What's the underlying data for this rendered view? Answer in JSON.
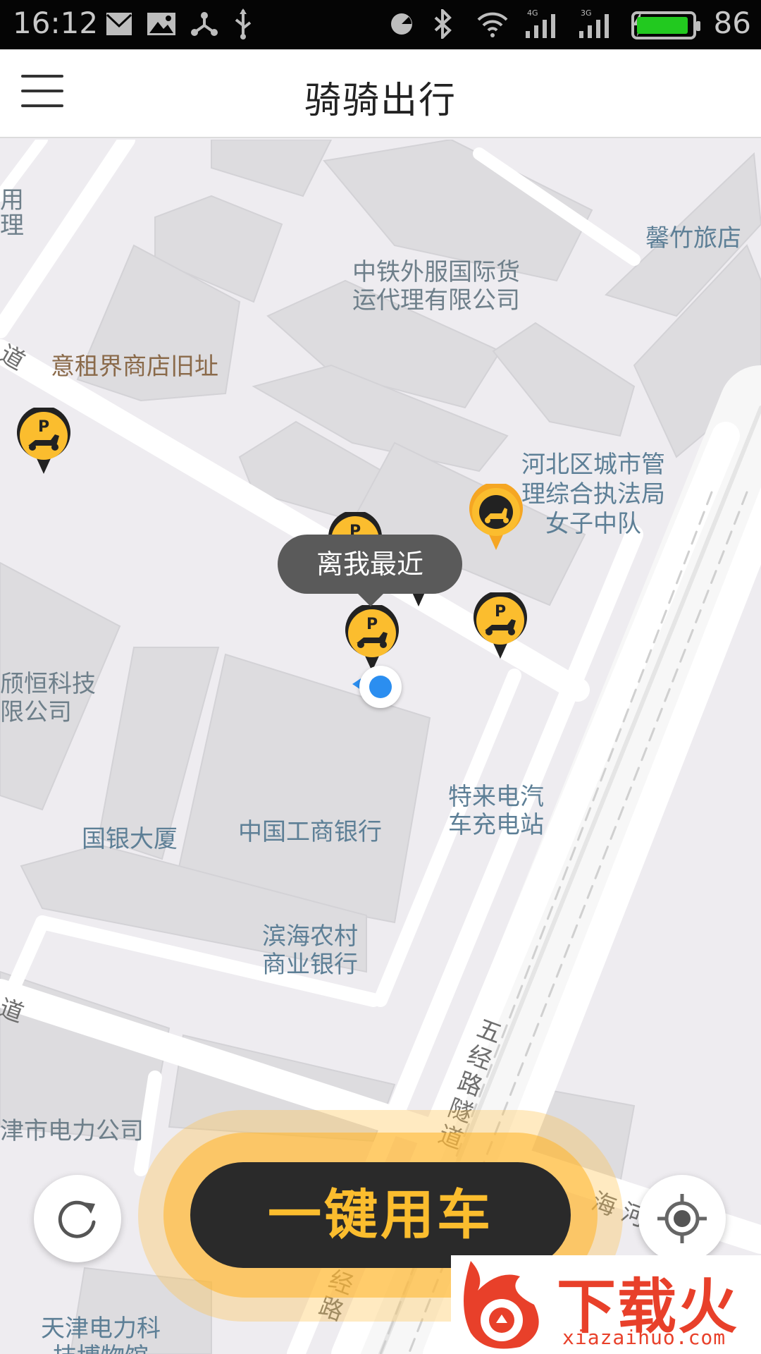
{
  "status_bar": {
    "time": "16:12",
    "battery_percent": "86",
    "battery_color": "#22c91f",
    "icons": [
      "mail-icon",
      "image-icon",
      "share-icon",
      "usb-icon",
      "alarm-icon",
      "bluetooth-icon",
      "wifi-icon",
      "signal-4g-icon",
      "signal-3g-icon",
      "charging-icon",
      "battery-icon"
    ],
    "network_4g": "4G",
    "network_3g": "3G"
  },
  "header": {
    "title": "骑骑出行",
    "menu_icon": "hamburger-menu-icon"
  },
  "map": {
    "pois": [
      {
        "name": "馨竹旅店"
      },
      {
        "name": "中铁外服国际货\n运代理有限公司"
      },
      {
        "name": "意租界商店旧址"
      },
      {
        "name": "河北区城市管\n理综合执法局\n女子中队"
      },
      {
        "name": "颀恒科技\n限公司"
      },
      {
        "name": "特来电汽\n车充电站"
      },
      {
        "name": "国银大厦"
      },
      {
        "name": "中国工商银行"
      },
      {
        "name": "滨海农村\n商业银行"
      },
      {
        "name": "津市电力公司"
      },
      {
        "name": "天津电力科\n技博物馆"
      }
    ],
    "road_labels": {
      "road_dao_1": "道",
      "road_dao_2": "道",
      "road_partial_top": "用\n理",
      "wujing_road": "五\n经\n路\n隧\n道",
      "hai_partial": "海 河",
      "jing_road_partial": "经\n路"
    },
    "tooltip": "离我最近",
    "accent_color": "#fbbd2e"
  },
  "controls": {
    "refresh_icon": "refresh-icon",
    "locate_icon": "locate-target-icon",
    "ride_button_label": "一键用车"
  },
  "watermark": {
    "text": "下载火",
    "sub": "xiazaihuo.com"
  }
}
